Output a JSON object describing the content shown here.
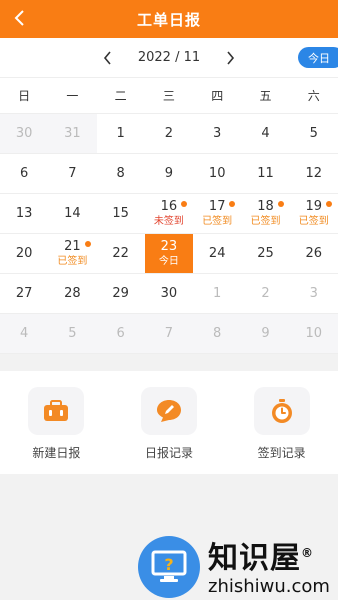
{
  "header": {
    "title": "工单日报"
  },
  "month_bar": {
    "label": "2022 / 11",
    "today_label": "今日"
  },
  "weekdays": [
    "日",
    "一",
    "二",
    "三",
    "四",
    "五",
    "六"
  ],
  "calendar": {
    "rows": [
      [
        {
          "day": "30",
          "other": true,
          "grey": true
        },
        {
          "day": "31",
          "other": true,
          "grey": true
        },
        {
          "day": "1"
        },
        {
          "day": "2"
        },
        {
          "day": "3"
        },
        {
          "day": "4"
        },
        {
          "day": "5"
        }
      ],
      [
        {
          "day": "6"
        },
        {
          "day": "7"
        },
        {
          "day": "8"
        },
        {
          "day": "9"
        },
        {
          "day": "10"
        },
        {
          "day": "11"
        },
        {
          "day": "12"
        }
      ],
      [
        {
          "day": "13"
        },
        {
          "day": "14"
        },
        {
          "day": "15"
        },
        {
          "day": "16",
          "status": "未签到",
          "status_color": "red",
          "dot": true
        },
        {
          "day": "17",
          "status": "已签到",
          "status_color": "orange",
          "dot": true
        },
        {
          "day": "18",
          "status": "已签到",
          "status_color": "orange",
          "dot": true
        },
        {
          "day": "19",
          "status": "已签到",
          "status_color": "orange",
          "dot": true
        }
      ],
      [
        {
          "day": "20"
        },
        {
          "day": "21",
          "status": "已签到",
          "status_color": "orange",
          "dot": true
        },
        {
          "day": "22"
        },
        {
          "day": "23",
          "status": "今日",
          "today": true
        },
        {
          "day": "24"
        },
        {
          "day": "25"
        },
        {
          "day": "26"
        }
      ],
      [
        {
          "day": "27"
        },
        {
          "day": "28"
        },
        {
          "day": "29"
        },
        {
          "day": "30"
        },
        {
          "day": "1",
          "other": true
        },
        {
          "day": "2",
          "other": true
        },
        {
          "day": "3",
          "other": true
        }
      ],
      [
        {
          "day": "4",
          "other": true,
          "grey": true
        },
        {
          "day": "5",
          "other": true,
          "grey": true
        },
        {
          "day": "6",
          "other": true,
          "grey": true
        },
        {
          "day": "7",
          "other": true,
          "grey": true
        },
        {
          "day": "8",
          "other": true,
          "grey": true
        },
        {
          "day": "9",
          "other": true,
          "grey": true
        },
        {
          "day": "10",
          "other": true,
          "grey": true
        }
      ]
    ]
  },
  "actions": [
    {
      "label": "新建日报",
      "icon": "briefcase-icon"
    },
    {
      "label": "日报记录",
      "icon": "edit-bubble-icon"
    },
    {
      "label": "签到记录",
      "icon": "stopwatch-icon"
    }
  ],
  "watermark": {
    "cn": "知识屋",
    "en": "zhishiwu.com",
    "reg": "®"
  },
  "colors": {
    "accent": "#f97d14",
    "blue": "#2b86e6",
    "red": "#e2452f"
  }
}
